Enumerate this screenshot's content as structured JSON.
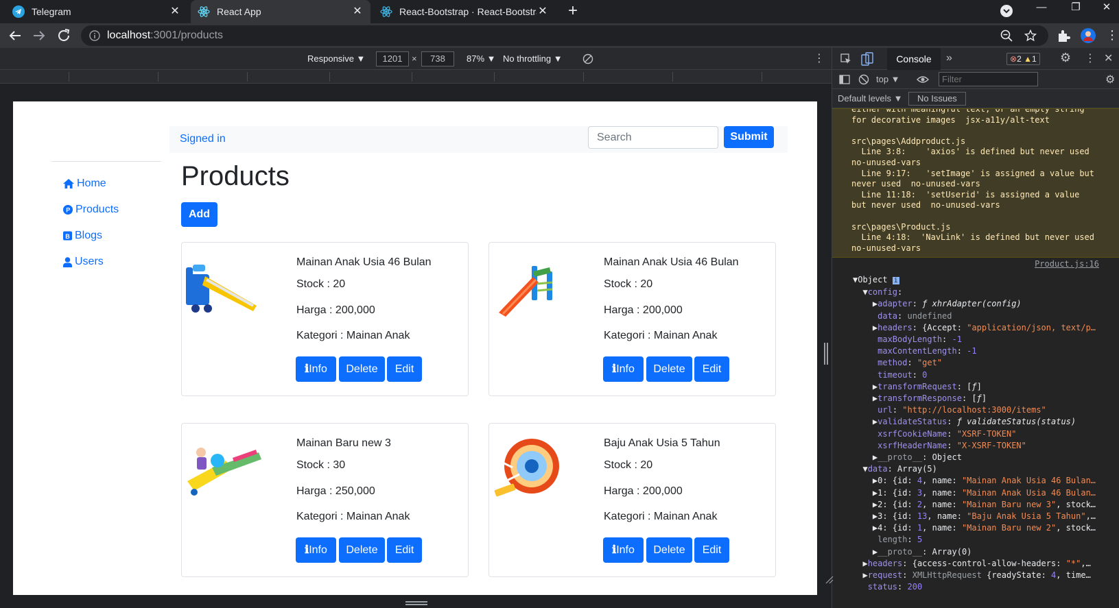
{
  "browser": {
    "tabs": [
      {
        "title": "Telegram",
        "active": false
      },
      {
        "title": "React App",
        "active": true
      },
      {
        "title": "React-Bootstrap · React-Bootstrap",
        "active": false
      }
    ],
    "url": {
      "host": "localhost",
      "path": ":3001/products"
    }
  },
  "device_toolbar": {
    "mode": "Responsive ▼",
    "width": "1201",
    "times": "×",
    "height": "738",
    "zoom": "87% ▼",
    "throttling": "No throttling ▼"
  },
  "app": {
    "navbar": {
      "signed_in": "Signed in",
      "search_placeholder": "Search",
      "submit": "Submit"
    },
    "sidebar": [
      {
        "label": "Home",
        "icon": "home-icon"
      },
      {
        "label": "Products",
        "icon": "product-p-icon"
      },
      {
        "label": "Blogs",
        "icon": "blog-b-icon"
      },
      {
        "label": "Users",
        "icon": "user-icon"
      }
    ],
    "page_title": "Products",
    "add_button": "Add",
    "buttons": {
      "info": "Info",
      "delete": "Delete",
      "edit": "Edit"
    },
    "products": [
      {
        "name": "Mainan Anak Usia 46 Bulan",
        "stock": "Stock : 20",
        "harga": "Harga : 200,000",
        "kategori": "Kategori : Mainan Anak",
        "image": "toy-slide-blue-yellow"
      },
      {
        "name": "Mainan Anak Usia 46 Bulan",
        "stock": "Stock : 20",
        "harga": "Harga : 200,000",
        "kategori": "Kategori : Mainan Anak",
        "image": "toy-slide-orange"
      },
      {
        "name": "Mainan Baru new 3",
        "stock": "Stock : 30",
        "harga": "Harga : 250,000",
        "kategori": "Kategori : Mainan Anak",
        "image": "toy-slide-multicolor"
      },
      {
        "name": "Baju Anak Usia 5 Tahun",
        "stock": "Stock : 20",
        "harga": "Harga : 200,000",
        "kategori": "Kategori : Mainan Anak",
        "image": "toy-wheel-track"
      }
    ]
  },
  "devtools": {
    "active_tab": "Console",
    "errors": "2",
    "warnings": "1",
    "context": "top ▼",
    "filter_placeholder": "Filter",
    "levels": "Default levels ▼",
    "issues": "No Issues",
    "source_link": "Product.js:16",
    "colors": {
      "warning_bg": "#413c26",
      "warning_text": "#ffe9b5",
      "string": "#f28b54",
      "key": "#9e91ec",
      "number": "#9980ff"
    }
  }
}
